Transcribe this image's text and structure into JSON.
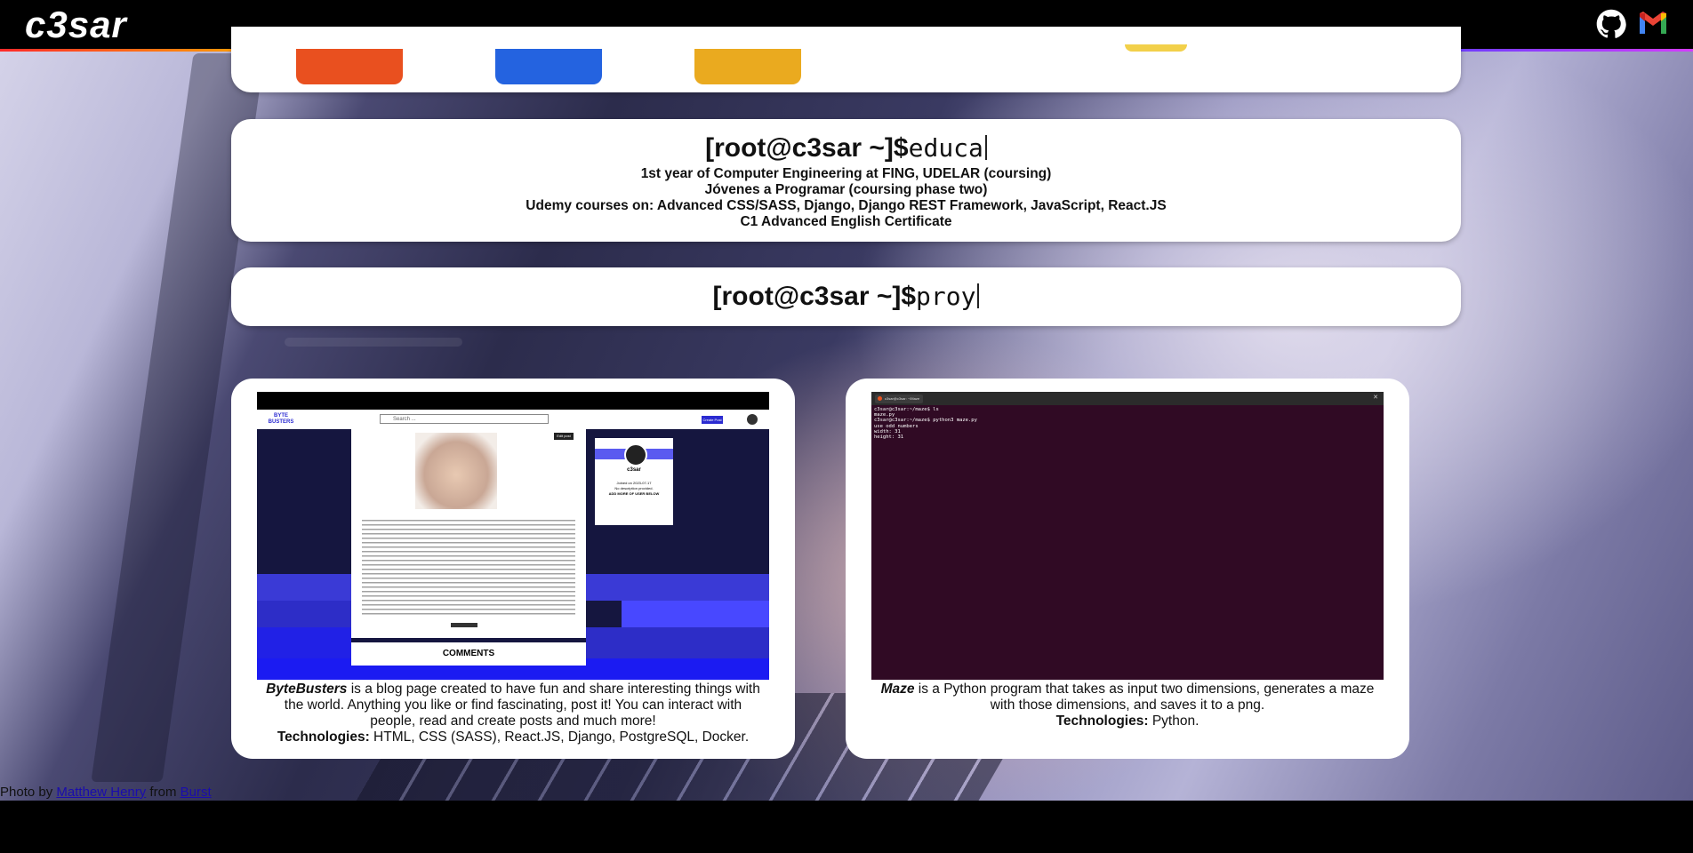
{
  "header": {
    "logo": "c3sar",
    "github_icon": "github-icon",
    "gmail_icon": "gmail-icon"
  },
  "skills": {
    "hex_colors": [
      "#e9501f",
      "#2463e0",
      "#eaaa1f"
    ]
  },
  "educa": {
    "prompt": "[root@c3sar ~]$",
    "command": "educa",
    "lines": [
      "1st year of Computer Engineering at FING, UDELAR (coursing)",
      "Jóvenes a Programar (coursing phase two)",
      "Udemy courses on: Advanced CSS/SASS, Django, Django REST Framework, JavaScript, React.JS",
      "C1 Advanced English Certificate"
    ]
  },
  "proy": {
    "prompt": "[root@c3sar ~]$",
    "command": "proy"
  },
  "projects": [
    {
      "name": "ByteBusters",
      "description": " is a blog page created to have fun and share interesting things with the world. Anything you like or find fascinating, post it! You can interact with people, read and create posts and much more!",
      "tech_label": "Technologies:",
      "tech": " HTML, CSS (SASS), React.JS, Django, PostgreSQL, Docker.",
      "screenshot": {
        "brand": "BYTE BUSTERS",
        "search_placeholder": "Search ...",
        "new_post": "Create Post",
        "profile_name": "c3sar",
        "profile_joined": "Joined on 2023-07-17",
        "profile_desc": "No description provided.",
        "profile_more": "ADD MORE OF USER BELOW",
        "comments": "COMMENTS",
        "edit_post": "Edit post"
      }
    },
    {
      "name": "Maze",
      "description": " is a Python program that takes as input two dimensions, generates a maze with those dimensions, and saves it to a png.",
      "tech_label": "Technologies:",
      "tech": " Python.",
      "screenshot": {
        "window_title": "c3sar@c3sar: ~/Maze",
        "lines": [
          "c3sar@c3sar:~/maze$ ls",
          "maze.py",
          "c3sar@c3sar:~/maze$ python3 maze.py",
          "use odd numbers",
          "width: 31",
          "height: 31"
        ]
      }
    }
  ],
  "credit": {
    "prefix": "Photo by ",
    "author": "Matthew Henry",
    "middle": " from ",
    "source": "Burst"
  }
}
